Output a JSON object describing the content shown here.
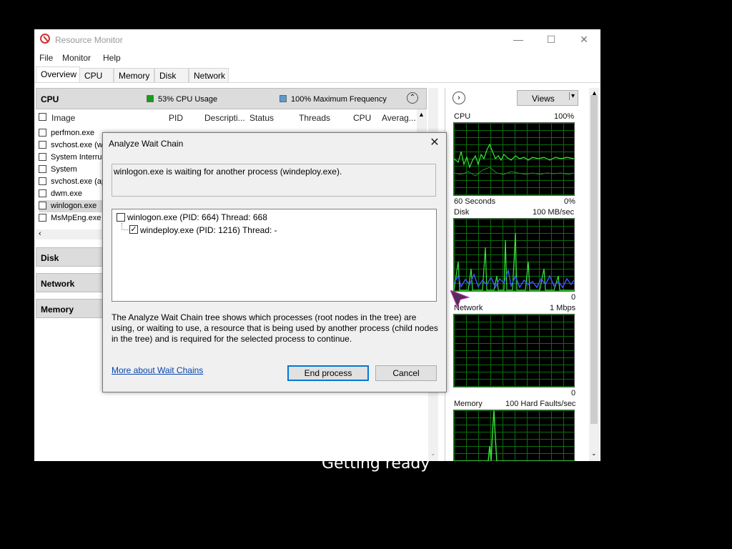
{
  "window": {
    "title": "Resource Monitor",
    "minimize": "—",
    "maximize": "☐",
    "close": "✕"
  },
  "menu": [
    "File",
    "Monitor",
    "Help"
  ],
  "tabs": [
    "Overview",
    "CPU",
    "Memory",
    "Disk",
    "Network"
  ],
  "cpu_section": {
    "title": "CPU",
    "usage": "53% CPU Usage",
    "usage_color": "#1a9c1a",
    "frequency": "100% Maximum Frequency",
    "frequency_color": "#5b9bd5"
  },
  "cpu_table": {
    "columns": [
      "Image",
      "PID",
      "Descripti...",
      "Status",
      "Threads",
      "CPU",
      "Averag..."
    ],
    "rows": [
      "perfmon.exe",
      "svchost.exe (w",
      "System Interrup",
      "System",
      "svchost.exe (ap",
      "dwm.exe",
      "winlogon.exe",
      "MsMpEng.exe"
    ],
    "selected": "winlogon.exe"
  },
  "sections": [
    "Disk",
    "Network",
    "Memory"
  ],
  "right_panel": {
    "views_label": "Views",
    "graphs": [
      {
        "name": "CPU",
        "max": "100%",
        "footer_left": "60 Seconds",
        "footer_right": "0%"
      },
      {
        "name": "Disk",
        "max": "100 MB/sec",
        "footer_left": "",
        "footer_right": "0"
      },
      {
        "name": "Network",
        "max": "1 Mbps",
        "footer_left": "",
        "footer_right": "0"
      },
      {
        "name": "Memory",
        "max": "100 Hard Faults/sec"
      }
    ]
  },
  "dialog": {
    "title": "Analyze Wait Chain",
    "message": "winlogon.exe is waiting for another process (windeploy.exe).",
    "tree": [
      {
        "label": "winlogon.exe (PID: 664) Thread: 668",
        "checked": false
      },
      {
        "label": "windeploy.exe (PID: 1216) Thread: -",
        "checked": true
      }
    ],
    "description": "The Analyze Wait Chain tree shows which processes (root nodes in the tree) are using, or waiting to use, a resource that is being used by another process (child nodes in the tree) and is required for the selected process to continue.",
    "link": "More about Wait Chains",
    "end_button": "End process",
    "cancel_button": "Cancel",
    "close_glyph": "✕"
  },
  "overlay_text": "Getting ready",
  "icons": [
    "resource-monitor-icon",
    "collapse-icon",
    "expand-arrow-icon",
    "dropdown-icon",
    "scroll-up-icon",
    "scroll-down-icon",
    "checkbox-icon",
    "cursor-icon"
  ]
}
